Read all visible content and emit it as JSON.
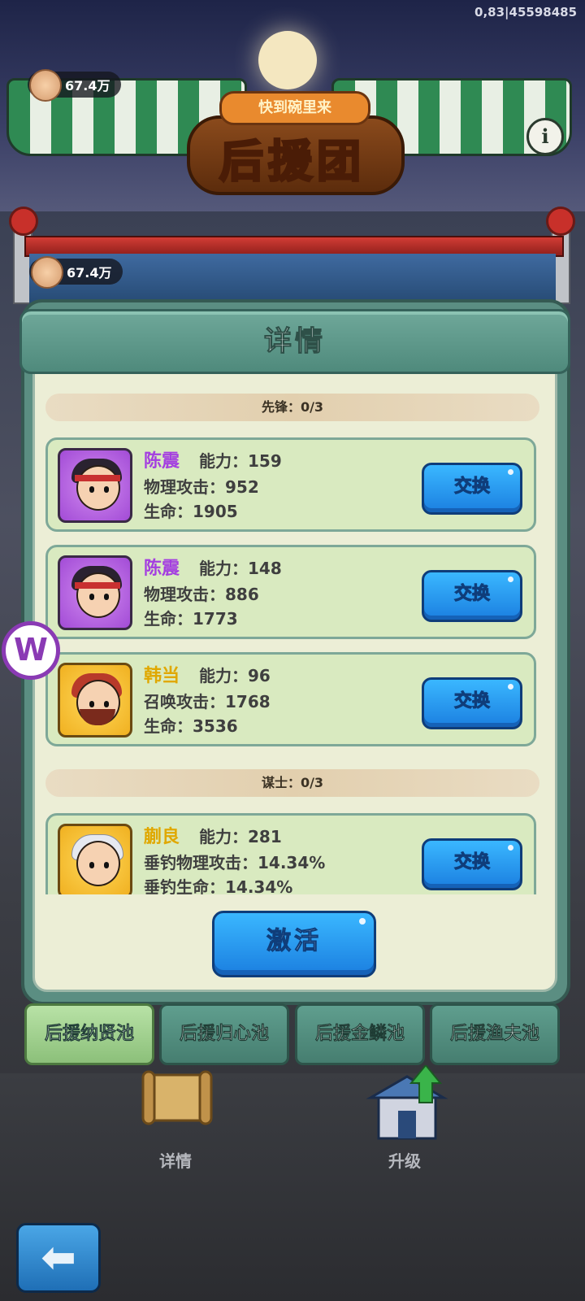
{
  "version": "0,83|45598485",
  "coins": {
    "top": "67.4万",
    "middle": "67.4万"
  },
  "sign": {
    "subtitle": "快到碗里来",
    "title": "后援团"
  },
  "info_icon": "info-icon",
  "side_badge": "W",
  "dialog": {
    "title": "详情",
    "sections": [
      {
        "label": "先锋：0/3"
      },
      {
        "label": "谋士：0/3"
      }
    ],
    "cards": [
      {
        "name": "陈震",
        "rarity": "purple",
        "ability": "能力：159",
        "stat1": "物理攻击：952",
        "stat2": "生命：1905",
        "button": "交换"
      },
      {
        "name": "陈震",
        "rarity": "purple",
        "ability": "能力：148",
        "stat1": "物理攻击：886",
        "stat2": "生命：1773",
        "button": "交换"
      },
      {
        "name": "韩当",
        "rarity": "gold",
        "ability": "能力：96",
        "stat1": "召唤攻击：1768",
        "stat2": "生命：3536",
        "button": "交换"
      },
      {
        "name": "蒯良",
        "rarity": "gold",
        "ability": "能力：281",
        "stat1": "垂钓物理攻击：14.34%",
        "stat2": "垂钓生命：14.34%",
        "button": "交换"
      }
    ],
    "activate": "激活"
  },
  "tabs": [
    {
      "label": "后援纳贤池",
      "active": true
    },
    {
      "label": "后援归心池",
      "active": false
    },
    {
      "label": "后援金鳞池",
      "active": false
    },
    {
      "label": "后援渔夫池",
      "active": false
    }
  ],
  "bottom": {
    "details": "详情",
    "upgrade": "升级"
  },
  "colors": {
    "accent_blue": "#1b7fe0",
    "panel_green": "#5b8e82",
    "card_bg": "#d9eac0",
    "purple_name": "#a43ee0",
    "gold_name": "#e0a800"
  }
}
